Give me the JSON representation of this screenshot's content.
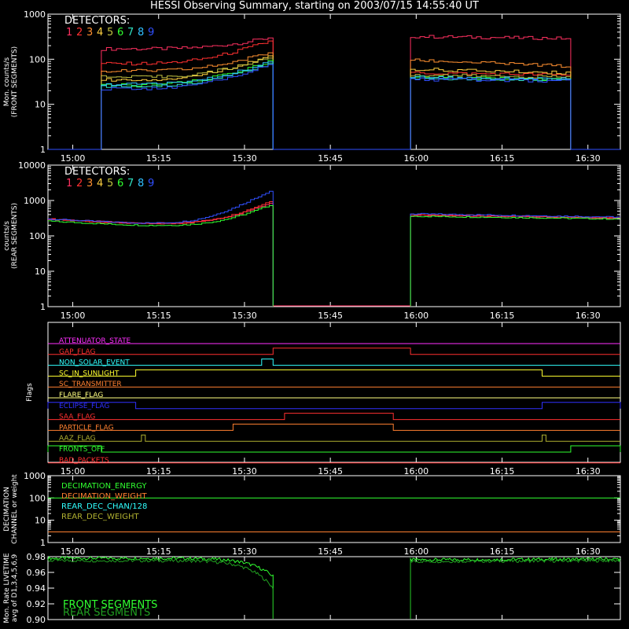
{
  "title": "HESSI Observing Summary, starting on 2003/07/15 14:55:40 UT",
  "x_ticks": [
    "15:00",
    "15:15",
    "15:30",
    "15:45",
    "16:00",
    "16:15",
    "16:30"
  ],
  "colors": {
    "det1": "#ff3060",
    "det2": "#ff3030",
    "det3": "#ff9030",
    "det4": "#ffd040",
    "det5": "#c0c040",
    "det6": "#30ff30",
    "det7": "#30e0c0",
    "det8": "#30c0ff",
    "det9": "#3050ff",
    "green": "#30ff30",
    "red": "#ff3030",
    "magenta": "#ff30ff",
    "cyan": "#30ffff",
    "orange": "#ff8030",
    "yellow": "#ffff30",
    "blue": "#3030ff",
    "olive": "#b0b030",
    "yellow2": "#ffff80"
  },
  "chart_data": [
    {
      "type": "line",
      "name": "front",
      "ylabel": "Mon. counts/s\n(FRONT SEGMENTS)",
      "ylabel_lines": [
        "Mon. counts/s",
        "(FRONT SEGMENTS)"
      ],
      "yscale": "log",
      "ylim": [
        1,
        1000
      ],
      "y_ticks": [
        "1",
        "10",
        "100",
        "1000"
      ],
      "legend_title": "DETECTORS:",
      "legend": [
        "1",
        "2",
        "3",
        "4",
        "5",
        "6",
        "7",
        "8",
        "9"
      ],
      "x_range": [
        "14:55:40",
        "16:35:40"
      ],
      "series": [
        {
          "name": "1",
          "intervals": [
            {
              "start": "15:05",
              "end": "15:35",
              "from": 170,
              "to": 300
            },
            {
              "start": "15:59",
              "end": "16:27",
              "from": 320,
              "to": 290
            }
          ]
        },
        {
          "name": "2",
          "intervals": [
            {
              "start": "15:05",
              "end": "15:35",
              "from": 80,
              "to": 250
            },
            {
              "start": "15:59",
              "end": "16:27",
              "from": 50,
              "to": 45
            }
          ]
        },
        {
          "name": "3",
          "intervals": [
            {
              "start": "15:05",
              "end": "15:35",
              "from": 55,
              "to": 140
            },
            {
              "start": "15:59",
              "end": "16:27",
              "from": 95,
              "to": 70
            }
          ]
        },
        {
          "name": "4",
          "intervals": [
            {
              "start": "15:05",
              "end": "15:35",
              "from": 35,
              "to": 120
            },
            {
              "start": "15:59",
              "end": "16:27",
              "from": 60,
              "to": 50
            }
          ]
        },
        {
          "name": "5",
          "intervals": [
            {
              "start": "15:05",
              "end": "15:35",
              "from": 40,
              "to": 110
            },
            {
              "start": "15:59",
              "end": "16:27",
              "from": 45,
              "to": 40
            }
          ]
        },
        {
          "name": "6",
          "intervals": [
            {
              "start": "15:05",
              "end": "15:35",
              "from": 27,
              "to": 90
            },
            {
              "start": "15:59",
              "end": "16:27",
              "from": 40,
              "to": 35
            }
          ]
        },
        {
          "name": "7",
          "intervals": [
            {
              "start": "15:05",
              "end": "15:35",
              "from": 25,
              "to": 80
            },
            {
              "start": "15:59",
              "end": "16:27",
              "from": 38,
              "to": 35
            }
          ]
        },
        {
          "name": "8",
          "intervals": [
            {
              "start": "15:05",
              "end": "15:35",
              "from": 28,
              "to": 85
            },
            {
              "start": "15:59",
              "end": "16:27",
              "from": 40,
              "to": 36
            }
          ]
        },
        {
          "name": "9",
          "intervals": [
            {
              "start": "15:05",
              "end": "15:35",
              "from": 22,
              "to": 75
            },
            {
              "start": "15:59",
              "end": "16:27",
              "from": 36,
              "to": 33
            }
          ]
        }
      ]
    },
    {
      "type": "line",
      "name": "rear",
      "ylabel": "counts/s\n(REAR SEGMENTS)",
      "ylabel_lines": [
        "counts/s",
        "(REAR SEGMENTS)"
      ],
      "yscale": "log",
      "ylim": [
        1,
        10000
      ],
      "y_ticks": [
        "1",
        "10",
        "100",
        "1000",
        "10000"
      ],
      "legend_title": "DETECTORS:",
      "legend": [
        "1",
        "2",
        "3",
        "4",
        "5",
        "6",
        "7",
        "8",
        "9"
      ],
      "x_range": [
        "14:55:40",
        "16:35:40"
      ],
      "series": [
        {
          "name": "1",
          "intervals": [
            {
              "start": "14:55:40",
              "end": "15:35",
              "from": 300,
              "to": 800
            },
            {
              "start": "15:59",
              "end": "16:35:40",
              "from": 380,
              "to": 320
            }
          ]
        },
        {
          "name": "2",
          "intervals": [
            {
              "start": "14:55:40",
              "end": "15:35",
              "from": 290,
              "to": 900
            },
            {
              "start": "15:59",
              "end": "16:35:40",
              "from": 400,
              "to": 330
            }
          ]
        },
        {
          "name": "9",
          "intervals": [
            {
              "start": "14:55:40",
              "end": "15:35",
              "from": 300,
              "to": 1800
            },
            {
              "start": "15:59",
              "end": "16:35:40",
              "from": 420,
              "to": 340
            }
          ]
        },
        {
          "name": "6",
          "intervals": [
            {
              "start": "14:55:40",
              "end": "15:35",
              "from": 260,
              "to": 700
            },
            {
              "start": "15:59",
              "end": "16:35:40",
              "from": 360,
              "to": 300
            }
          ]
        }
      ]
    },
    {
      "type": "flags",
      "name": "flags",
      "ylabel": "Flags",
      "x_range": [
        "14:55:40",
        "16:35:40"
      ],
      "flags": [
        {
          "name": "ATTENUATOR_STATE",
          "color": "magenta",
          "on": []
        },
        {
          "name": "GAP_FLAG",
          "color": "red",
          "on": [
            [
              "15:35",
              "15:59"
            ]
          ]
        },
        {
          "name": "NON_SOLAR_EVENT",
          "color": "cyan",
          "on": [
            [
              "15:33",
              "15:35"
            ]
          ]
        },
        {
          "name": "SC_IN_SUNLIGHT",
          "color": "yellow",
          "on": [
            [
              "15:11",
              "16:22"
            ]
          ]
        },
        {
          "name": "SC_TRANSMITTER",
          "color": "orange",
          "on": []
        },
        {
          "name": "FLARE_FLAG",
          "color": "yellow2",
          "on": []
        },
        {
          "name": "ECLIPSE_FLAG",
          "color": "blue",
          "on": [
            [
              "14:55:40",
              "15:11"
            ],
            [
              "16:22",
              "16:35:40"
            ]
          ]
        },
        {
          "name": "SAA_FLAG",
          "color": "red",
          "on": [
            [
              "15:37",
              "15:56"
            ]
          ]
        },
        {
          "name": "PARTICLE_FLAG",
          "color": "orange",
          "on": [
            [
              "15:28",
              "15:56"
            ]
          ]
        },
        {
          "name": "AAZ_FLAG",
          "color": "olive",
          "on": [
            [
              "15:12",
              "15:12:40"
            ],
            [
              "16:22",
              "16:22:40"
            ]
          ]
        },
        {
          "name": "FRONTS_OFF",
          "color": "green",
          "on": [
            [
              "14:55:40",
              "15:05"
            ],
            [
              "16:27",
              "16:35:40"
            ]
          ]
        },
        {
          "name": "BAD_PACKETS",
          "color": "red",
          "on": []
        }
      ]
    },
    {
      "type": "line",
      "name": "decimation",
      "ylabel": "DECIMATION\nCHANNEL or weight",
      "ylabel_lines": [
        "DECIMATION",
        "CHANNEL or weight"
      ],
      "yscale": "log",
      "ylim": [
        1,
        1000
      ],
      "y_ticks": [
        "1",
        "10",
        "100",
        "1000"
      ],
      "legend": [
        "DECIMATION_ENERGY",
        "DECIMATION_WEIGHT",
        "REAR_DEC_CHAN/128",
        "REAR_DEC_WEIGHT"
      ],
      "x_range": [
        "14:55:40",
        "16:35:40"
      ],
      "series": [
        {
          "name": "DECIMATION_ENERGY",
          "value": 100,
          "color": "green"
        },
        {
          "name": "DECIMATION_WEIGHT",
          "value": 1,
          "color": "orange"
        }
      ]
    },
    {
      "type": "line",
      "name": "livetime",
      "ylabel": "Mon. Rate LIVETIME\navg of D1,3,4,5,6,9",
      "ylabel_lines": [
        "Mon. Rate LIVETIME",
        "avg of D1,3,4,5,6,9"
      ],
      "ylim": [
        0.9,
        0.98
      ],
      "y_ticks": [
        "0.90",
        "0.92",
        "0.94",
        "0.96",
        "0.98"
      ],
      "legend": [
        "FRONT SEGMENTS",
        "REAR SEGMENTS"
      ],
      "x_range": [
        "14:55:40",
        "16:35:40"
      ],
      "series": [
        {
          "name": "FRONT SEGMENTS",
          "intervals": [
            {
              "start": "14:55:40",
              "end": "15:35",
              "from": 0.978,
              "to": 0.955
            },
            {
              "start": "15:59",
              "end": "16:35:40",
              "from": 0.976,
              "to": 0.977
            }
          ]
        },
        {
          "name": "REAR SEGMENTS",
          "intervals": [
            {
              "start": "14:55:40",
              "end": "15:35",
              "from": 0.975,
              "to": 0.94
            },
            {
              "start": "15:59",
              "end": "16:35:40",
              "from": 0.974,
              "to": 0.975
            }
          ]
        }
      ]
    }
  ]
}
